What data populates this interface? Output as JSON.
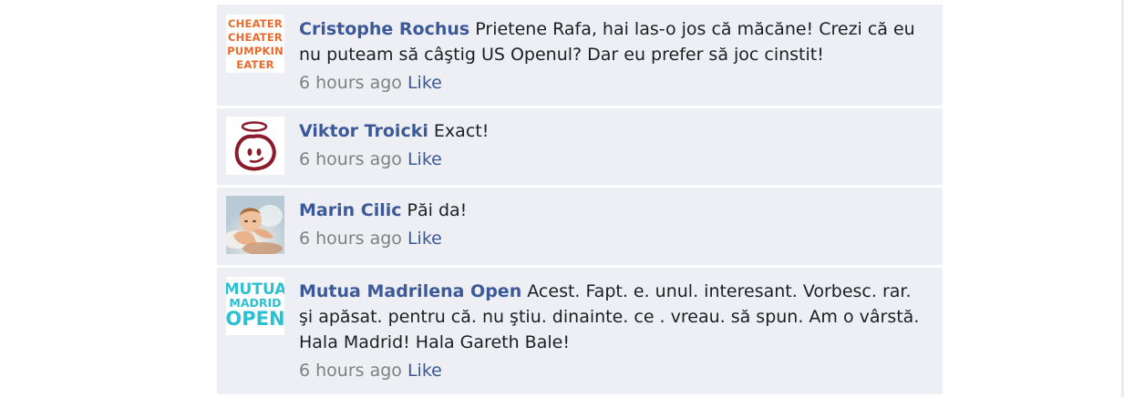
{
  "comments": [
    {
      "author": "Cristophe Rochus",
      "text": "Prietene Rafa, hai las-o jos că măcăne! Crezi că eu nu puteam să câştig US Openul? Dar eu prefer să joc cinstit!",
      "time": "6 hours ago",
      "like": "Like",
      "avatar": {
        "icon": "cheater-text-avatar",
        "lines": [
          "CHEATER",
          "CHEATER",
          "PUMPKIN",
          "EATER"
        ],
        "color": "#e86a2c"
      }
    },
    {
      "author": "Viktor Troicki",
      "text": "Exact!",
      "time": "6 hours ago",
      "like": "Like",
      "avatar": {
        "icon": "halo-face-avatar",
        "color": "#8b1a2b"
      }
    },
    {
      "author": "Marin Cilic",
      "text": "Păi da!",
      "time": "6 hours ago",
      "like": "Like",
      "avatar": {
        "icon": "cherub-photo-avatar"
      }
    },
    {
      "author": "Mutua Madrilena Open",
      "text": "Acest. Fapt. e. unul. interesant. Vorbesc. rar. şi apăsat. pentru că. nu ştiu. dinainte. ce . vreau. să spun. Am o vârstă. Hala Madrid! Hala Gareth Bale!",
      "time": "6 hours ago",
      "like": "Like",
      "avatar": {
        "icon": "mutua-madrid-open-logo",
        "lines": [
          "MUTUA",
          "MADRID",
          "OPEN"
        ],
        "color": "#2cc0d3"
      }
    }
  ],
  "colors": {
    "name": "#3b5998",
    "row_bg": "#edeff4",
    "meta": "#808080",
    "text": "#1c1e21"
  }
}
